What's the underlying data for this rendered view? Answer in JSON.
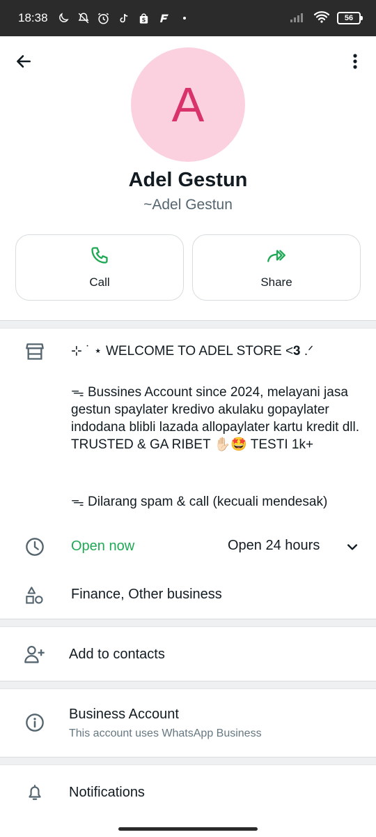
{
  "status_bar": {
    "time": "18:38",
    "battery": "56",
    "icons": [
      "moon-icon",
      "mute-icon",
      "alarm-icon",
      "tiktok-icon",
      "shopee-icon",
      "f-icon",
      "dot-icon"
    ],
    "right_icons": [
      "signal-icon",
      "wifi-icon",
      "battery-icon"
    ]
  },
  "header": {
    "back_icon": "arrow-back-icon",
    "menu_icon": "more-vert-icon"
  },
  "profile": {
    "avatar_letter": "A",
    "avatar_bg": "#fbd1e0",
    "avatar_fg": "#d8336a",
    "name": "Adel Gestun",
    "pushname": "~Adel Gestun"
  },
  "actions": [
    {
      "label": "Call",
      "icon": "phone-icon"
    },
    {
      "label": "Share",
      "icon": "share-icon"
    }
  ],
  "business": {
    "icon": "store-icon",
    "desc_line1": "⊹ ˙ ⋆ WELCOME TO ADEL STORE <𝟑 .ᐟ",
    "desc_para2": "ᯓ Bussines Account since 2024, melayani jasa gestun spaylater kredivo akulaku gopaylater indodana blibli lazada allopaylater kartu kredit dll. TRUSTED & GA RIBET ✋🏻🤩 TESTI 1k+",
    "desc_para3": "ᯓ Dilarang spam & call (kecuali mendesak)",
    "open_status": "Open now",
    "open_hours": "Open 24 hours",
    "category": "Finance, Other business",
    "accent_color": "#1fa855"
  },
  "list": {
    "add_contacts": "Add to contacts",
    "business_account_title": "Business Account",
    "business_account_sub": "This account uses WhatsApp Business",
    "notifications": "Notifications"
  }
}
